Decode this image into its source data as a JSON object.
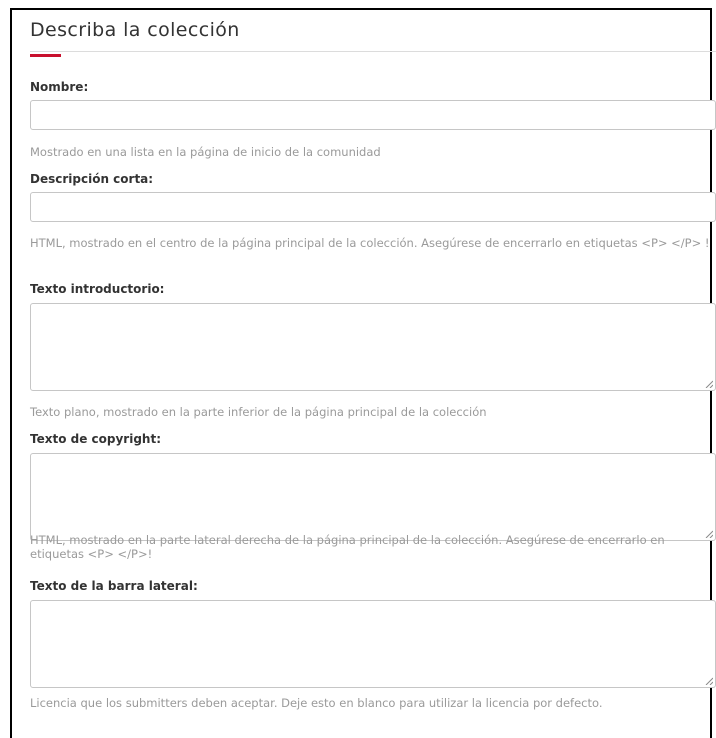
{
  "form": {
    "title": "Describa la colección",
    "name": {
      "label": "Nombre:",
      "value": "",
      "help": "Mostrado en una lista en la página de inicio de la comunidad"
    },
    "short_description": {
      "label": "Descripción corta:",
      "value": "",
      "help": "HTML, mostrado en el centro de la página principal de la colección. Asegúrese de encerrarlo en etiquetas <P> </P> !"
    },
    "introductory_text": {
      "label": "Texto introductorio:",
      "value": "",
      "help": "Texto plano, mostrado en la parte inferior de la página principal de la colección"
    },
    "copyright_text": {
      "label": "Texto de copyright:",
      "value": "",
      "help": "HTML, mostrado en la parte lateral derecha de la página principal de la colección. Asegúrese de encerrarlo en etiquetas <P> </P>!"
    },
    "sidebar_text": {
      "label": "Texto de la barra lateral:",
      "value": "",
      "help": "Licencia que los submitters deben aceptar. Deje esto en blanco para utilizar la licencia por defecto."
    }
  },
  "colors": {
    "accent": "#c8102e",
    "help_text": "#9a9a9a",
    "field_border": "#c6c6c6"
  },
  "icons": {
    "resize": "resize-grip-icon"
  }
}
